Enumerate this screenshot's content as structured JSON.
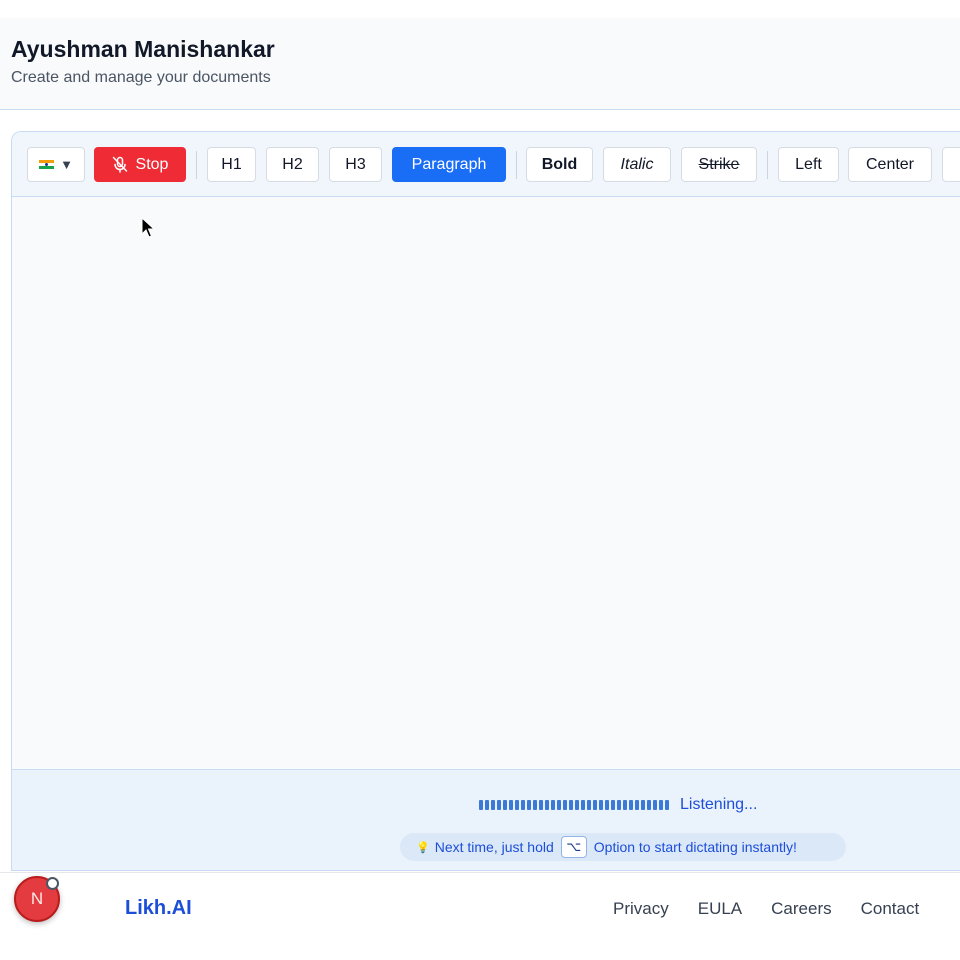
{
  "header": {
    "title": "Ayushman Manishankar",
    "subtitle": "Create and manage your documents"
  },
  "toolbar": {
    "language_caret": "▼",
    "stop_label": "Stop",
    "h1_label": "H1",
    "h2_label": "H2",
    "h3_label": "H3",
    "paragraph_label": "Paragraph",
    "bold_label": "Bold",
    "italic_label": "Italic",
    "strike_label": "Strike",
    "left_label": "Left",
    "center_label": "Center",
    "active_block": "Paragraph"
  },
  "status": {
    "listening_label": "Listening...",
    "hint_prefix": "Next time, just hold",
    "hint_key": "⌥",
    "hint_suffix": "Option to start dictating instantly!"
  },
  "footer": {
    "brand": "Likh.AI",
    "links": [
      "Privacy",
      "EULA",
      "Careers",
      "Contact"
    ]
  },
  "dev_indicator": {
    "letter": "N"
  },
  "colors": {
    "accent": "#1a6ef5",
    "stop": "#ef2b36",
    "brand": "#1d4ed8"
  },
  "icons": {
    "language": "india-flag-icon",
    "stop": "mic-off-icon",
    "hint": "lightbulb-icon"
  }
}
